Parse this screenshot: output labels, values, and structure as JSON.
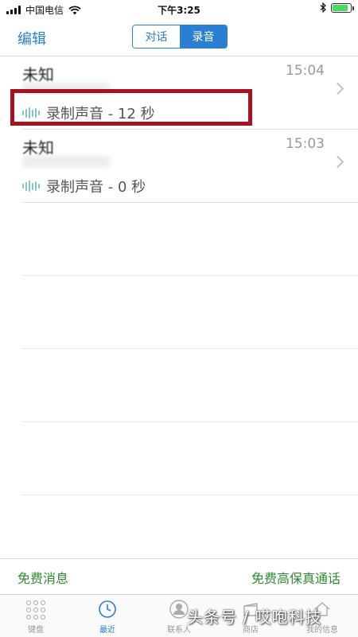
{
  "status_bar": {
    "carrier": "中国电信",
    "time": "下午3:25",
    "battery_level": 0.85,
    "battery_color": "#4cd964"
  },
  "nav": {
    "edit": "编辑",
    "segments": [
      "对话",
      "录音"
    ],
    "active_segment": "录音",
    "accent_color": "#2b7fd3"
  },
  "recordings": [
    {
      "title": "未知",
      "time": "15:04",
      "detail": "录制声音 - 12 秒",
      "highlighted": true
    },
    {
      "title": "未知",
      "time": "15:03",
      "detail": "录制声音 - 0 秒",
      "highlighted": false
    }
  ],
  "promo": {
    "left": "免费消息",
    "right": "免费高保真通话",
    "color": "#2f8a2f"
  },
  "tabs": [
    {
      "label": "键盘",
      "icon": "keypad-icon"
    },
    {
      "label": "最近",
      "icon": "clock-icon",
      "active": true
    },
    {
      "label": "联系人",
      "icon": "person-icon"
    },
    {
      "label": "商店",
      "icon": "store-icon"
    },
    {
      "label": "我的信息",
      "icon": "home-icon"
    }
  ],
  "watermark": "头条号 / 哎咆科技"
}
